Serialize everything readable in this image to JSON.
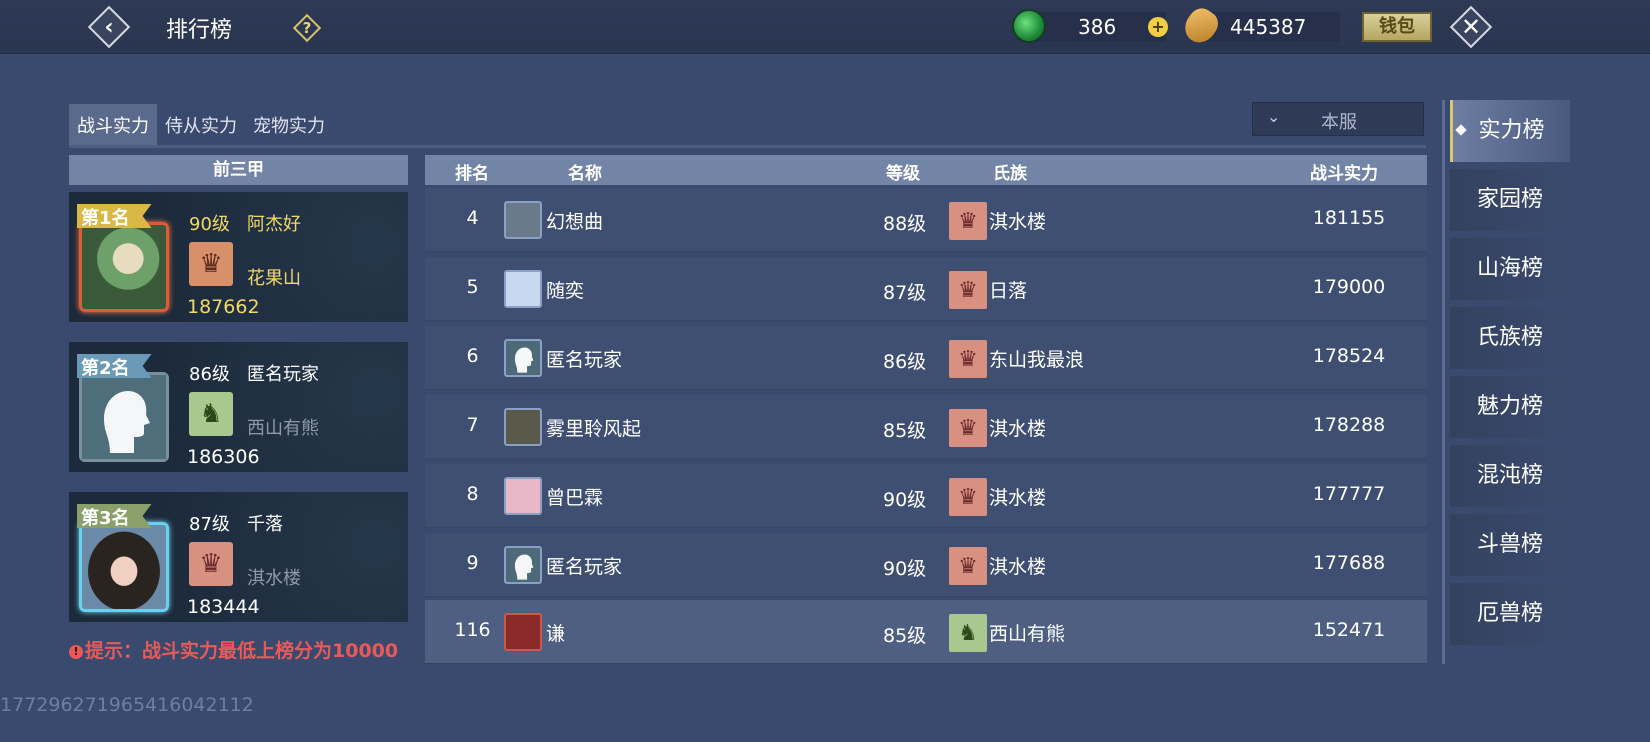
{
  "header": {
    "title": "排行榜",
    "help_glyph": "?",
    "back_glyph": "‹",
    "close_glyph": "✕",
    "currency_jade": "386",
    "currency_gold": "445387",
    "plus_glyph": "+",
    "wallet_label": "钱包"
  },
  "tabs": [
    {
      "label": "战斗实力",
      "active": true
    },
    {
      "label": "侍从实力",
      "active": false
    },
    {
      "label": "宠物实力",
      "active": false
    }
  ],
  "server_filter": {
    "value": "本服",
    "icon": "chevron-down-icon"
  },
  "top3": {
    "header": "前三甲",
    "entries": [
      {
        "rank_label": "第1名",
        "level": "90级",
        "name": "阿杰好",
        "clan": "花果山",
        "power": "187662",
        "ribbon_color": "#d9b846",
        "text_color": "#f0d86a",
        "emblem_color": "#d8906a",
        "avatar_style": "fox"
      },
      {
        "rank_label": "第2名",
        "level": "86级",
        "name": "匿名玩家",
        "clan": "西山有熊",
        "power": "186306",
        "ribbon_color": "#6a9ab8",
        "text_color": "#ffffff",
        "emblem_color": "#a8c890",
        "avatar_style": "silhouette"
      },
      {
        "rank_label": "第3名",
        "level": "87级",
        "name": "千落",
        "clan": "淇水楼",
        "power": "183444",
        "ribbon_color": "#8aa06a",
        "text_color": "#ffffff",
        "emblem_color": "#d89080",
        "avatar_style": "girl"
      }
    ],
    "hint": "提示：战斗实力最低上榜分为10000",
    "hint_icon": "!"
  },
  "table": {
    "columns": {
      "rank": "排名",
      "name": "名称",
      "level": "等级",
      "clan": "氏族",
      "power": "战斗实力"
    },
    "rows": [
      {
        "rank": "4",
        "name": "幻想曲",
        "level": "88级",
        "clan": "淇水楼",
        "power": "181155",
        "clan_color": "#d89080",
        "avatar_color": "#6a7a8a",
        "is_self": false
      },
      {
        "rank": "5",
        "name": "随奕",
        "level": "87级",
        "clan": "日落",
        "power": "179000",
        "clan_color": "#d89080",
        "avatar_color": "#c8d8ee",
        "is_self": false
      },
      {
        "rank": "6",
        "name": "匿名玩家",
        "level": "86级",
        "clan": "东山我最浪",
        "power": "178524",
        "clan_color": "#d89080",
        "avatar_color": "#4c6a78",
        "is_self": false
      },
      {
        "rank": "7",
        "name": "雾里聆风起",
        "level": "85级",
        "clan": "淇水楼",
        "power": "178288",
        "clan_color": "#d89080",
        "avatar_color": "#5a5a4a",
        "is_self": false
      },
      {
        "rank": "8",
        "name": "曾巴霖",
        "level": "90级",
        "clan": "淇水楼",
        "power": "177777",
        "clan_color": "#d89080",
        "avatar_color": "#e8b8c8",
        "is_self": false
      },
      {
        "rank": "9",
        "name": "匿名玩家",
        "level": "90级",
        "clan": "淇水楼",
        "power": "177688",
        "clan_color": "#d89080",
        "avatar_color": "#4c6a78",
        "is_self": false
      },
      {
        "rank": "116",
        "name": "谦",
        "level": "85级",
        "clan": "西山有熊",
        "power": "152471",
        "clan_color": "#a8c890",
        "avatar_color": "#8a2a2a",
        "is_self": true
      }
    ]
  },
  "side_menu": [
    {
      "label": "实力榜",
      "active": true
    },
    {
      "label": "家园榜",
      "active": false
    },
    {
      "label": "山海榜",
      "active": false
    },
    {
      "label": "氏族榜",
      "active": false
    },
    {
      "label": "魅力榜",
      "active": false
    },
    {
      "label": "混沌榜",
      "active": false
    },
    {
      "label": "斗兽榜",
      "active": false
    },
    {
      "label": "厄兽榜",
      "active": false
    }
  ],
  "footer_id": "177296271965416042112"
}
